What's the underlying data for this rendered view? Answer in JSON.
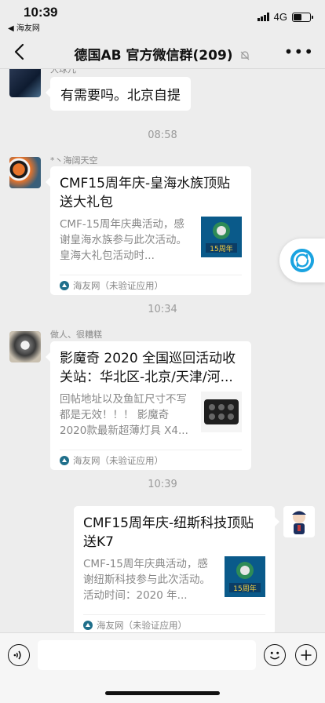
{
  "status_bar": {
    "time": "10:39",
    "back_app": "◀ 海友网",
    "network": "4G",
    "battery_level": 0.5
  },
  "nav": {
    "title": "德国AB 官方微信群(209)",
    "more": "•••"
  },
  "messages": [
    {
      "sender": "大球儿",
      "text": "有需要吗。北京自提"
    },
    {
      "time": "08:58"
    },
    {
      "sender": "*丶海阔天空",
      "card": {
        "title": "CMF15周年庆-皇海水族顶贴送大礼包",
        "desc": "CMF-15周年庆典活动，感谢皇海水族参与此次活动。皇海大礼包活动时...",
        "source": "海友网（未验证应用）"
      }
    },
    {
      "time": "10:34"
    },
    {
      "sender": "做人、很糟糕",
      "card": {
        "title": "影魔奇 2020 全国巡回活动收关站：华北区-北京/天津/河...",
        "desc": "回帖地址以及鱼缸尺寸不写都是无效！！！ 影魔奇 2020款最新超薄灯具 X4...",
        "source": "海友网（未验证应用）"
      }
    },
    {
      "time": "10:39"
    },
    {
      "card": {
        "title": "CMF15周年庆-纽斯科技顶贴送K7",
        "desc": "CMF-15周年庆典活动，感谢纽斯科技参与此次活动。活动时间：2020 年...",
        "source": "海友网（未验证应用）"
      }
    }
  ],
  "thumb_label": "15周年",
  "icons": {
    "back": "chevron-left-icon",
    "mute": "bell-off-icon",
    "voice": "voice-icon",
    "emoji": "emoji-icon",
    "plus": "plus-icon",
    "float": "refresh-icon"
  },
  "colors": {
    "background": "#ededed",
    "bubble": "#ffffff",
    "timestamp": "#9a9a9a",
    "float_accent": "#1aa3e0"
  }
}
